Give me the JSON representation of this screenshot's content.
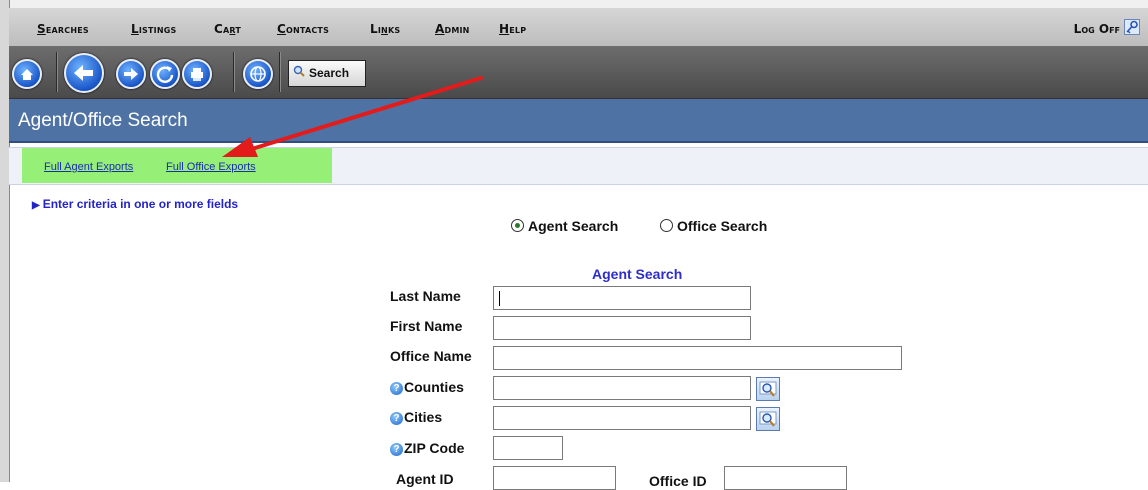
{
  "menu": {
    "items": [
      {
        "first": "S",
        "rest": "earches"
      },
      {
        "first": "L",
        "rest": "istings"
      },
      {
        "first": "Ca",
        "ul": "r",
        "rest": "t"
      },
      {
        "first": "C",
        "rest": "ontacts"
      },
      {
        "first": "Li",
        "ul": "n",
        "rest": "ks"
      },
      {
        "first": "A",
        "rest": "dmin"
      },
      {
        "first": "H",
        "rest": "elp"
      }
    ],
    "logoff": "Log Off"
  },
  "toolbar": {
    "search_label": "Search",
    "icons": [
      "home-icon",
      "back-icon",
      "forward-icon",
      "refresh-icon",
      "print-icon",
      "globe-icon"
    ]
  },
  "page": {
    "title": "Agent/Office Search"
  },
  "exports": {
    "agent": "Full Agent Exports",
    "office": "Full Office Exports"
  },
  "hint": "Enter criteria in one or more fields",
  "mode": {
    "agent_label": "Agent Search",
    "office_label": "Office Search",
    "selected": "Agent Search"
  },
  "form": {
    "title": "Agent Search",
    "last_name": {
      "label": "Last Name",
      "value": ""
    },
    "first_name": {
      "label": "First Name",
      "value": ""
    },
    "office_name": {
      "label": "Office Name",
      "value": ""
    },
    "counties": {
      "label": "Counties",
      "value": ""
    },
    "cities": {
      "label": "Cities",
      "value": ""
    },
    "zip": {
      "label": "ZIP Code",
      "value": ""
    },
    "agent_id": {
      "label": "Agent ID",
      "value": ""
    },
    "office_id": {
      "label": "Office ID",
      "value": ""
    }
  },
  "colors": {
    "title_bar": "#4e72a4",
    "highlight": "#90ee70",
    "annotation_arrow": "#e31b1b",
    "link": "#1a2db0"
  }
}
